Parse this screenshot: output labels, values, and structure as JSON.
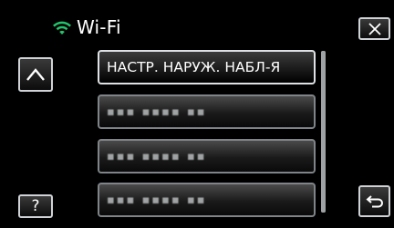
{
  "header": {
    "title": "Wi-Fi",
    "wifi_icon": "wifi-signal-icon",
    "wifi_color": "#23c36b"
  },
  "buttons": {
    "close_icon": "close-icon",
    "scroll_up_icon": "chevron-up-icon",
    "help_label": "?",
    "back_icon": "return-arrow-icon"
  },
  "list": {
    "items": [
      {
        "label": "НАСТР. НАРУЖ. НАБЛ-Я"
      },
      {
        "label": "▪▪▪ ▪▪▪▪ ▪▪"
      },
      {
        "label": "▪▪▪ ▪▪▪▪ ▪▪"
      },
      {
        "label": "▪▪▪ ▪▪▪▪ ▪▪"
      }
    ]
  },
  "colors": {
    "background": "#000000",
    "button_border": "#cfd3d6",
    "item_border": "#7f8488",
    "accent_green": "#23c36b"
  }
}
